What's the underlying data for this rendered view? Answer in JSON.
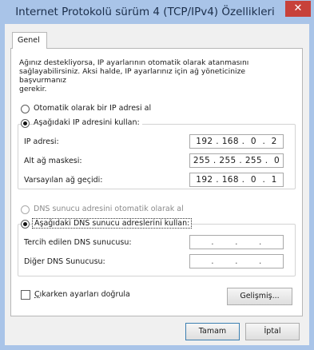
{
  "window": {
    "title": "Internet Protokolü sürüm 4 (TCP/IPv4) Özellikleri",
    "close_glyph": "✕"
  },
  "tabs": [
    {
      "label": "Genel"
    }
  ],
  "description": "Ağınız destekliyorsa, IP ayarlarının otomatik olarak atanmasını\nsağlayabilirsiniz. Aksi halde, IP ayarlarınız için ağ yöneticinize başvurmanız\ngerekir.",
  "ip": {
    "auto_label": "Otomatik olarak bir IP adresi al",
    "auto_selected": false,
    "manual_label": "Aşağıdaki IP adresini kullan:",
    "manual_selected": true,
    "fields": [
      {
        "label": "IP adresi:",
        "value": "192 . 168 .  0  .  2"
      },
      {
        "label": "Alt ağ maskesi:",
        "value": "255 . 255 . 255 .  0"
      },
      {
        "label": "Varsayılan ağ geçidi:",
        "value": "192 . 168 .  0  .  1"
      }
    ]
  },
  "dns": {
    "auto_label": "DNS sunucu adresini otomatik olarak al",
    "auto_selected": false,
    "auto_enabled": false,
    "manual_label": "Aşağıdaki DNS sunucu adreslerini kullan:",
    "manual_selected": true,
    "fields": [
      {
        "label": "Tercih edilen DNS sunucusu:",
        "value": "  .       .       .  "
      },
      {
        "label": "Diğer DNS Sunucusu:",
        "value": "  .       .       .  "
      }
    ]
  },
  "validate_on_exit": {
    "label_prefix": "Ç",
    "label_rest": "ıkarken ayarları doğrula",
    "checked": false
  },
  "buttons": {
    "advanced": "Gelişmiş...",
    "ok": "Tamam",
    "cancel": "İptal"
  },
  "colors": {
    "frame": "#a9c4e8",
    "close": "#c7413a",
    "focus_border": "#3c7fb1"
  },
  "icons": {
    "close": "close-icon"
  }
}
